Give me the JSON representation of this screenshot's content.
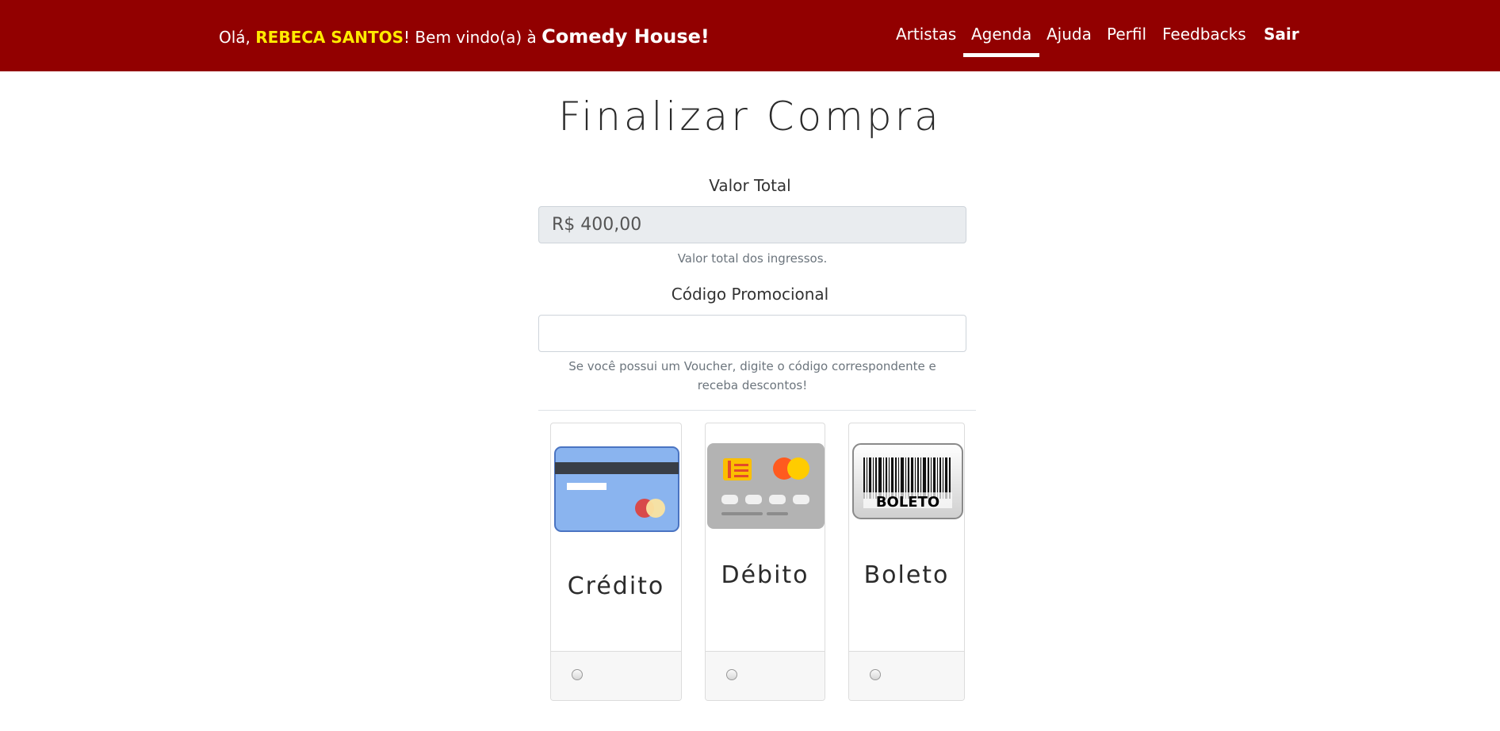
{
  "header": {
    "greeting_prefix": "Olá, ",
    "user_name": "REBECA SANTOS",
    "greeting_middle": "! Bem vindo(a) à ",
    "brand": "Comedy House!",
    "nav": [
      "Artistas",
      "Agenda",
      "Ajuda",
      "Perfil",
      "Feedbacks",
      "Sair"
    ],
    "active_nav": "Agenda"
  },
  "main": {
    "title": "Finalizar Compra",
    "total_label": "Valor Total",
    "total_value": "R$ 400,00",
    "total_help": "Valor total dos ingressos.",
    "promo_label": "Código Promocional",
    "promo_value": "",
    "promo_help": "Se você possui um Voucher, digite o código correspondente e receba descontos!"
  },
  "payment_options": [
    {
      "label": "Crédito",
      "icon": "credit-card-icon",
      "selected": false
    },
    {
      "label": "Débito",
      "icon": "debit-card-icon",
      "selected": false
    },
    {
      "label": "Boleto",
      "icon": "barcode-icon",
      "icon_text": "BOLETO",
      "selected": false
    }
  ],
  "colors": {
    "header_bg": "#920000",
    "user_highlight": "#ffeb00"
  }
}
